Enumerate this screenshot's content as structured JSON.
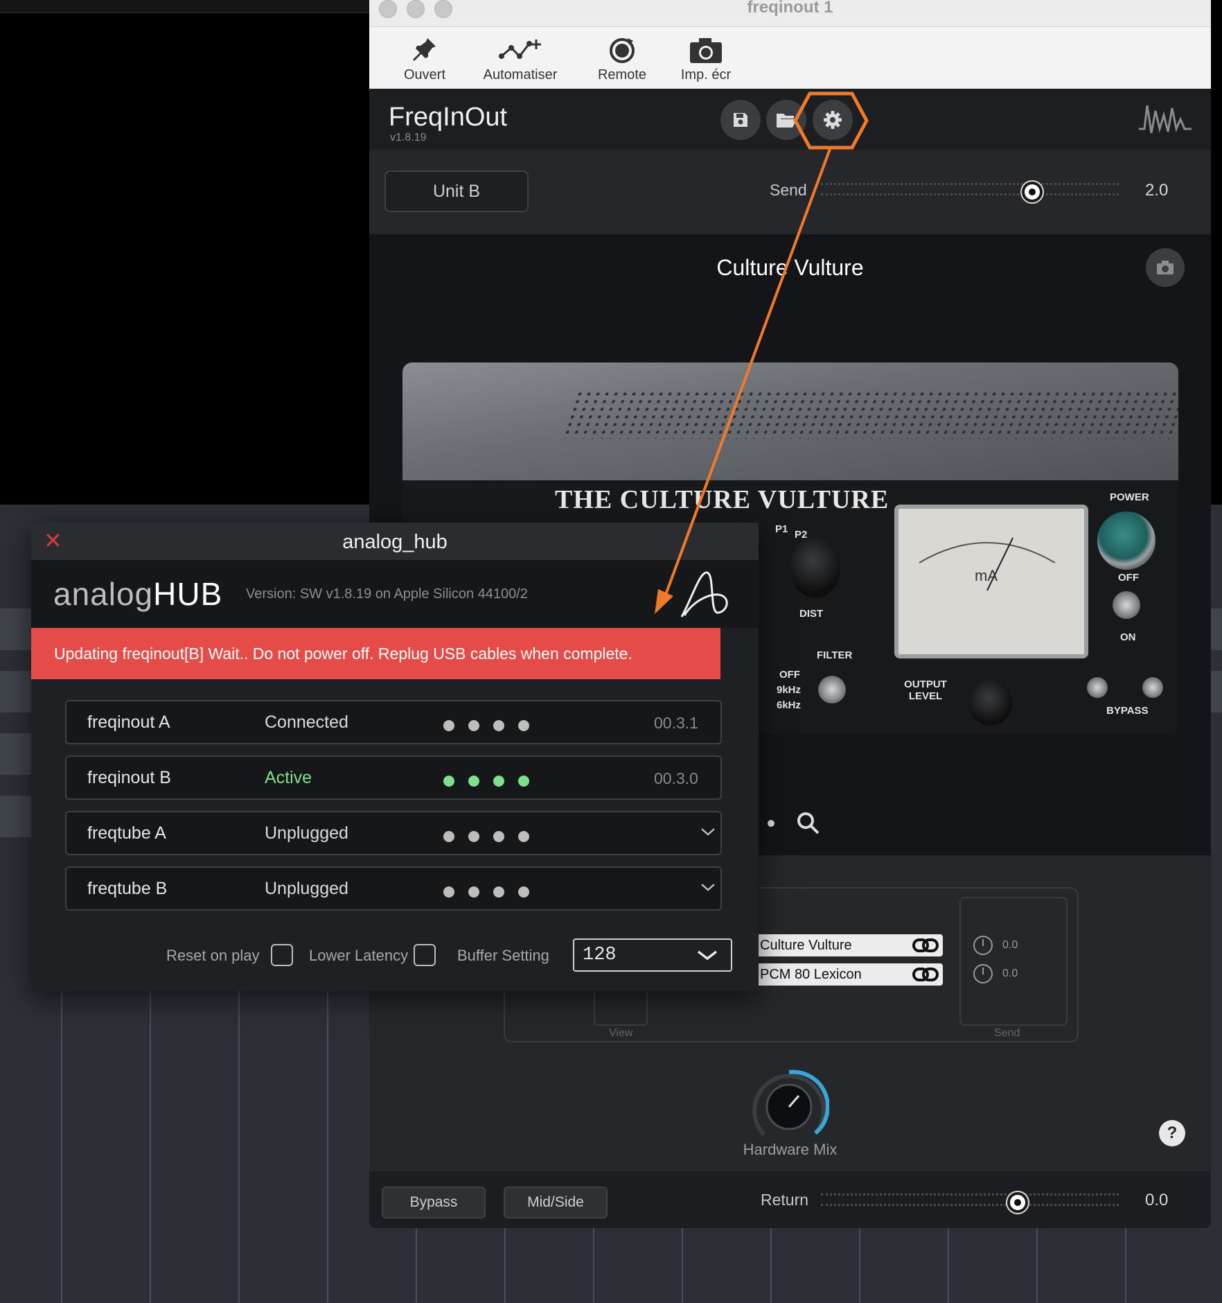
{
  "host": {
    "window_title": "freqinout 1",
    "toolbar": [
      {
        "label": "Ouvert",
        "icon": "pin-icon"
      },
      {
        "label": "Automatiser",
        "icon": "automation-icon"
      },
      {
        "label": "Remote",
        "icon": "remote-icon"
      },
      {
        "label": "Imp. écr",
        "icon": "camera-icon"
      }
    ]
  },
  "plugin": {
    "brand": "FreqInOut",
    "version": "v1.8.19",
    "unit_button": "Unit B",
    "send_label": "Send",
    "send_value": "2.0",
    "send_fraction": 0.71,
    "unit_name": "Culture Vulture",
    "photo": {
      "brand_text": "THE CULTURE VULTURE",
      "power": "POWER",
      "off": "OFF",
      "on": "ON",
      "filter": "FILTER",
      "filter_off": "OFF",
      "filter_9k": "9kHz",
      "filter_6k": "6kHz",
      "output_level": "OUTPUT LEVEL",
      "bypass": "BYPASS",
      "dist": "DIST",
      "p1": "P1",
      "p2": "P2",
      "meter_unit": "mA"
    },
    "routing": {
      "items": [
        "Culture Vulture",
        "PCM 80 Lexicon"
      ],
      "send_values": [
        "0.0",
        "0.0"
      ],
      "view_caption": "View",
      "send_caption": "Send"
    },
    "hardware_mix_label": "Hardware Mix",
    "help": "?",
    "footer": {
      "bypass": "Bypass",
      "midside": "Mid/Side",
      "return_label": "Return",
      "return_value": "0.0",
      "return_fraction": 0.66
    }
  },
  "hub": {
    "title": "analog_hub",
    "logo_light": "analog",
    "logo_bold": "HUB",
    "version": "Version: SW v1.8.19 on Apple Silicon  44100/2",
    "alert": "Updating freqinout[B] Wait.. Do not power off. Replug USB cables when complete.",
    "devices": [
      {
        "name": "freqinout A",
        "status": "Connected",
        "firmware": "00.3.1",
        "active": false
      },
      {
        "name": "freqinout B",
        "status": "Active",
        "firmware": "00.3.0",
        "active": true
      },
      {
        "name": "freqtube A",
        "status": "Unplugged",
        "firmware": "",
        "active": false
      },
      {
        "name": "freqtube B",
        "status": "Unplugged",
        "firmware": "",
        "active": false
      }
    ],
    "options": {
      "reset_on_play": "Reset on play",
      "lower_latency": "Lower Latency",
      "buffer_setting": "Buffer Setting",
      "buffer_value": "128"
    }
  },
  "colors": {
    "alert": "#e54b48",
    "active_green": "#7ee08a",
    "annotation_orange": "#f07a2a",
    "close_red": "#d33b3b"
  }
}
